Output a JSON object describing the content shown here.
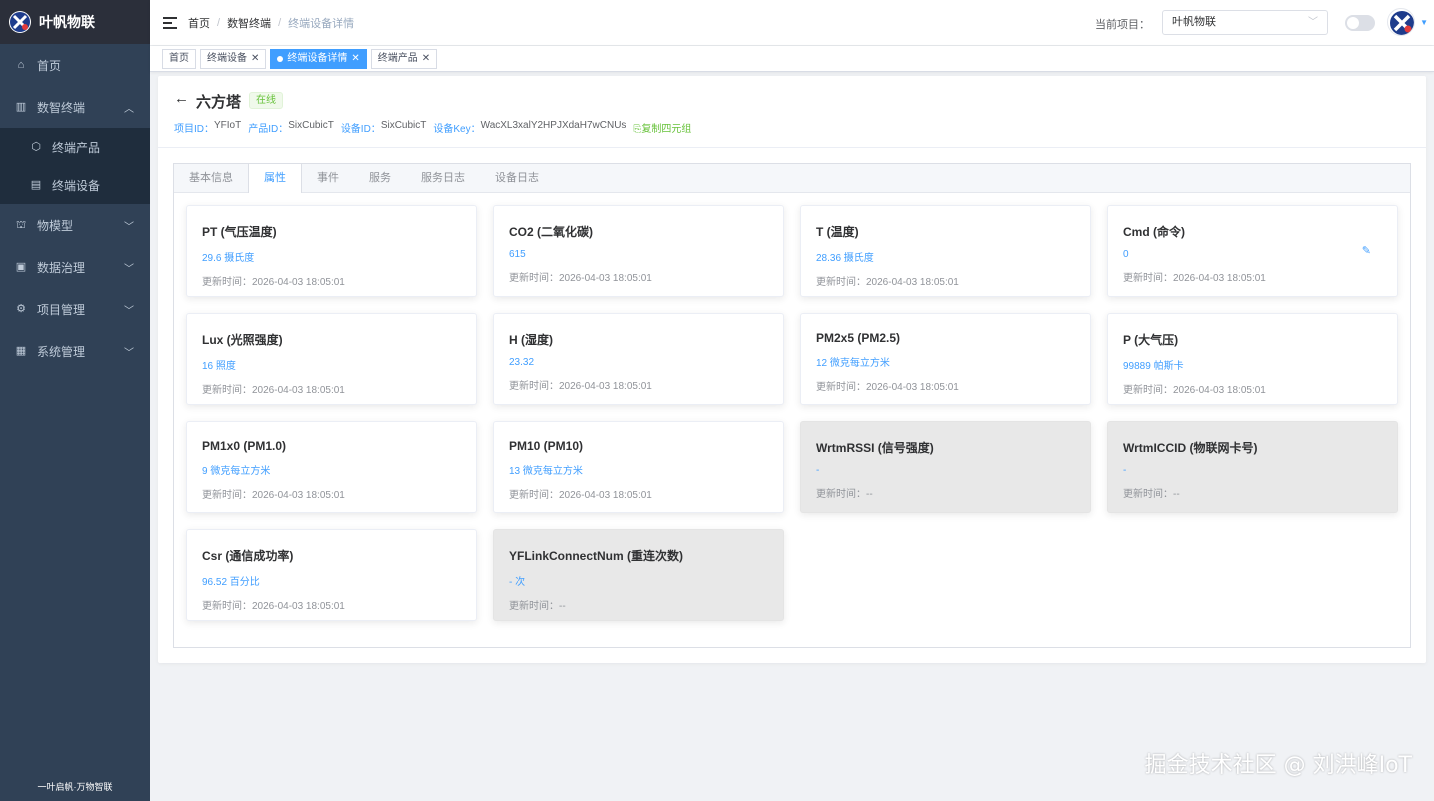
{
  "app": {
    "title": "叶帆物联",
    "footer": "一叶启帆·万物智联"
  },
  "sidebar": {
    "items": [
      {
        "label": "首页",
        "icon": "home-icon"
      },
      {
        "label": "数智终端",
        "icon": "terminal-icon",
        "expanded": true,
        "children": [
          {
            "label": "终端产品",
            "icon": "cube-icon"
          },
          {
            "label": "终端设备",
            "icon": "device-icon"
          }
        ]
      },
      {
        "label": "物模型",
        "icon": "model-icon"
      },
      {
        "label": "数据治理",
        "icon": "data-icon"
      },
      {
        "label": "项目管理",
        "icon": "project-icon"
      },
      {
        "label": "系统管理",
        "icon": "monitor-icon"
      }
    ]
  },
  "header": {
    "breadcrumb": [
      "首页",
      "数智终端",
      "终端设备详情"
    ],
    "project_label": "当前项目：",
    "project_value": "叶帆物联"
  },
  "tags": [
    {
      "label": "首页",
      "closable": false,
      "active": false
    },
    {
      "label": "终端设备",
      "closable": true,
      "active": false
    },
    {
      "label": "终端设备详情",
      "closable": true,
      "active": true
    },
    {
      "label": "终端产品",
      "closable": true,
      "active": false
    }
  ],
  "device": {
    "back": "←",
    "name": "六方塔",
    "status": "在线",
    "meta": {
      "project_id_key": "项目ID：",
      "project_id": "YFIoT",
      "product_id_key": "产品ID：",
      "product_id": "SixCubicT",
      "device_id_key": "设备ID：",
      "device_id": "SixCubicT",
      "device_key_key": "设备Key：",
      "device_key": "WacXL3xalY2HPJXdaH7wCNUs",
      "copy": "⎘复制四元组"
    }
  },
  "tabs": [
    "基本信息",
    "属性",
    "事件",
    "服务",
    "服务日志",
    "设备日志"
  ],
  "active_tab": "属性",
  "properties": [
    {
      "title": "PT (气压温度)",
      "value": "29.6 摄氏度",
      "time": "更新时间：2026-04-03 18:05:01",
      "disabled": false
    },
    {
      "title": "CO2 (二氧化碳)",
      "value": "615",
      "time": "更新时间：2026-04-03 18:05:01",
      "disabled": false
    },
    {
      "title": "T (温度)",
      "value": "28.36 摄氏度",
      "time": "更新时间：2026-04-03 18:05:01",
      "disabled": false
    },
    {
      "title": "Cmd (命令)",
      "value": "0",
      "time": "更新时间：2026-04-03 18:05:01",
      "disabled": false,
      "editable": true
    },
    {
      "title": "Lux (光照强度)",
      "value": "16 照度",
      "time": "更新时间：2026-04-03 18:05:01",
      "disabled": false
    },
    {
      "title": "H (湿度)",
      "value": "23.32",
      "time": "更新时间：2026-04-03 18:05:01",
      "disabled": false
    },
    {
      "title": "PM2x5 (PM2.5)",
      "value": "12 微克每立方米",
      "time": "更新时间：2026-04-03 18:05:01",
      "disabled": false
    },
    {
      "title": "P (大气压)",
      "value": "99889 帕斯卡",
      "time": "更新时间：2026-04-03 18:05:01",
      "disabled": false
    },
    {
      "title": "PM1x0 (PM1.0)",
      "value": "9 微克每立方米",
      "time": "更新时间：2026-04-03 18:05:01",
      "disabled": false
    },
    {
      "title": "PM10 (PM10)",
      "value": "13 微克每立方米",
      "time": "更新时间：2026-04-03 18:05:01",
      "disabled": false
    },
    {
      "title": "WrtmRSSI (信号强度)",
      "value": "-",
      "time": "更新时间：--",
      "disabled": true
    },
    {
      "title": "WrtmICCID (物联网卡号)",
      "value": "-",
      "time": "更新时间：--",
      "disabled": true
    },
    {
      "title": "Csr (通信成功率)",
      "value": "96.52 百分比",
      "time": "更新时间：2026-04-03 18:05:01",
      "disabled": false
    },
    {
      "title": "YFLinkConnectNum (重连次数)",
      "value": "- 次",
      "time": "更新时间：--",
      "disabled": true
    }
  ],
  "watermark": "掘金技术社区 @ 刘洪峰IoT",
  "colors": {
    "sidebar": "#304156",
    "accent": "#409eff",
    "online": "#67c23a"
  }
}
